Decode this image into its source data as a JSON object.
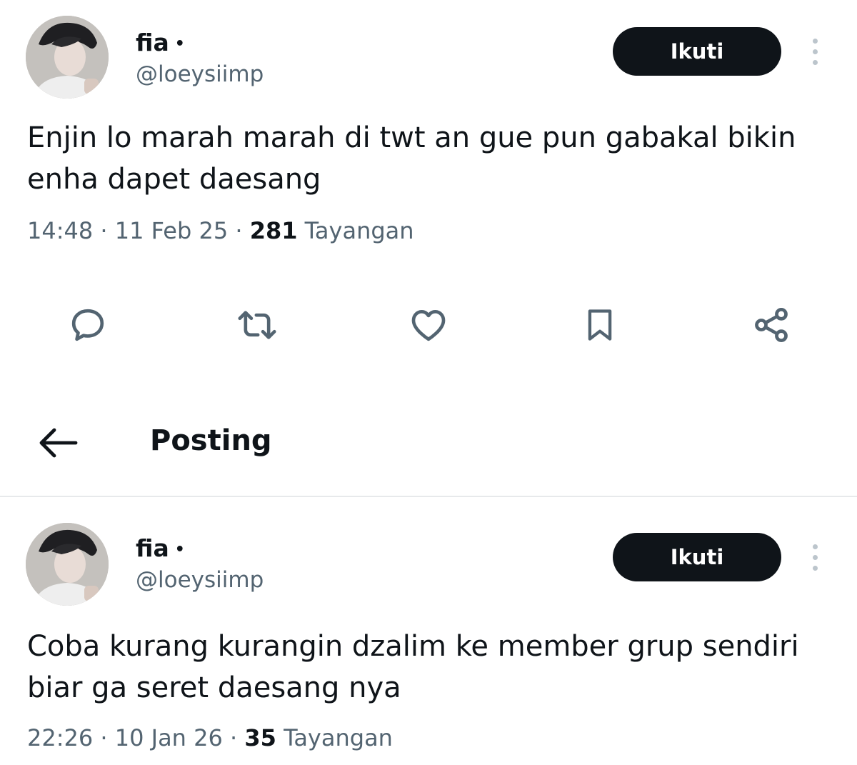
{
  "tweets": [
    {
      "name": "fia",
      "name_dot": "•",
      "handle": "@loeysiimp",
      "follow_label": "Ikuti",
      "text": "Enjin lo marah marah di twt an gue pun gabakal bikin enha dapet daesang",
      "time": "14:48",
      "date": "11 Feb 25",
      "separator": "·",
      "views_count": "281",
      "views_label": "Tayangan"
    },
    {
      "name": "fia",
      "name_dot": "•",
      "handle": "@loeysiimp",
      "follow_label": "Ikuti",
      "text": "Coba kurang kurangin dzalim ke member grup sendiri biar ga seret daesang nya",
      "time": "22:26",
      "date": "10 Jan 26",
      "separator": "·",
      "views_count": "35",
      "views_label": "Tayangan"
    }
  ],
  "actions": [
    "reply-icon",
    "retweet-icon",
    "like-icon",
    "bookmark-icon",
    "share-icon"
  ],
  "header": {
    "title": "Posting",
    "back_icon": "arrow-left-icon"
  },
  "colors": {
    "text": "#0f1419",
    "secondary": "#536471",
    "button_bg": "#0f1419",
    "button_text": "#ffffff",
    "divider": "#e7e9eb"
  }
}
